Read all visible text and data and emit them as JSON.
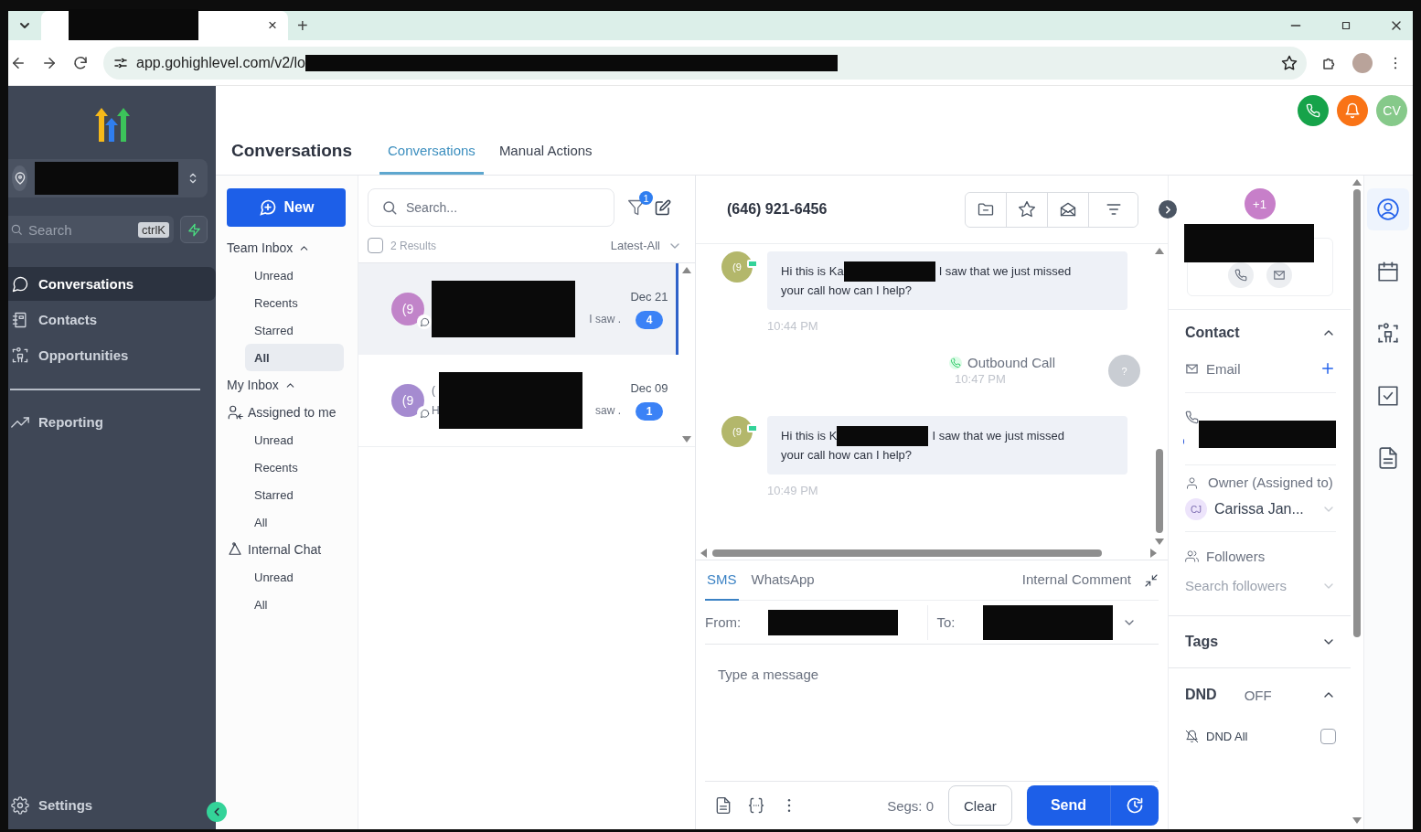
{
  "browser": {
    "tab_close": "×",
    "new_tab": "+",
    "url": "app.gohighlevel.com/v2/lo"
  },
  "sidebar": {
    "search": {
      "placeholder": "Search",
      "shortcut": "ctrlK"
    },
    "nav": [
      {
        "label": "Conversations",
        "selected": true
      },
      {
        "label": "Contacts",
        "selected": false
      },
      {
        "label": "Opportunities",
        "selected": false
      }
    ],
    "nav_secondary": [
      {
        "label": "Reporting",
        "selected": false
      }
    ],
    "settings": "Settings"
  },
  "header": {
    "title": "Conversations",
    "tabs": [
      {
        "label": "Conversations",
        "selected": true
      },
      {
        "label": "Manual Actions",
        "selected": false
      }
    ],
    "user_initials": "CV"
  },
  "inbox": {
    "new_button": "New",
    "entries": [
      {
        "kind": "section",
        "label": "Team Inbox",
        "expanded": true
      },
      {
        "kind": "item",
        "label": "Unread",
        "selected": false
      },
      {
        "kind": "item",
        "label": "Recents",
        "selected": false
      },
      {
        "kind": "item",
        "label": "Starred",
        "selected": false
      },
      {
        "kind": "item",
        "label": "All",
        "selected": true
      },
      {
        "kind": "section",
        "label": "My Inbox",
        "expanded": true
      },
      {
        "kind": "group",
        "label": "Assigned to me"
      },
      {
        "kind": "item",
        "label": "Unread",
        "selected": false
      },
      {
        "kind": "item",
        "label": "Recents",
        "selected": false
      },
      {
        "kind": "item",
        "label": "Starred",
        "selected": false
      },
      {
        "kind": "item",
        "label": "All",
        "selected": false
      },
      {
        "kind": "group",
        "label": "Internal Chat"
      },
      {
        "kind": "item",
        "label": "Unread",
        "selected": false
      },
      {
        "kind": "item",
        "label": "All",
        "selected": false
      }
    ]
  },
  "conversations": {
    "search_placeholder": "Search...",
    "filter_count": "1",
    "select_all": {
      "checked": false
    },
    "results": "2 Results",
    "sort": "Latest-All",
    "list": [
      {
        "avatar": "(9",
        "preview_tail": "I saw .",
        "date": "Dec 21",
        "unread": "4",
        "selected": true
      },
      {
        "avatar": "(9",
        "name_head": "(",
        "preview_head": "H",
        "preview_tail": "saw .",
        "date": "Dec 09",
        "unread": "1",
        "selected": false
      }
    ]
  },
  "chat": {
    "phone": "(646) 921-6456",
    "messages": [
      {
        "kind": "sms",
        "avatar": "(9",
        "head": "Hi this is Ka",
        "tail": "I saw that we just missed",
        "line2": "your call how can I help?",
        "time": "10:44 PM"
      },
      {
        "kind": "call",
        "label": "Outbound Call",
        "time": "10:47 PM",
        "avatar": "?"
      },
      {
        "kind": "sms",
        "avatar": "(9",
        "head": "Hi this is K",
        "tail": "I saw that we just missed",
        "line2": "your call how can I help?",
        "time": "10:49 PM"
      }
    ]
  },
  "composer": {
    "channels": [
      {
        "label": "SMS",
        "selected": true
      },
      {
        "label": "WhatsApp",
        "selected": false
      }
    ],
    "internal": {
      "label": "Internal Comment",
      "selected": false
    },
    "from_label": "From:",
    "to_label": "To:",
    "placeholder": "Type a message",
    "segments": "Segs: 0",
    "clear": "Clear",
    "send": "Send"
  },
  "contact": {
    "avatar": "+1",
    "section": {
      "label": "Contact",
      "expanded": true
    },
    "email": "Email",
    "owner_label": "Owner (Assigned to)",
    "owner_initials": "CJ",
    "owner": "Carissa Jan...",
    "followers": "Followers",
    "followers_placeholder": "Search followers",
    "tags": {
      "label": "Tags",
      "expanded": false
    },
    "dnd": {
      "label": "DND",
      "status": "OFF",
      "expanded": true
    },
    "dnd_all": {
      "label": "DND All",
      "checked": false
    }
  },
  "rail": [
    {
      "selected": true
    },
    {
      "selected": false
    },
    {
      "selected": false
    },
    {
      "selected": false
    },
    {
      "selected": false
    }
  ]
}
